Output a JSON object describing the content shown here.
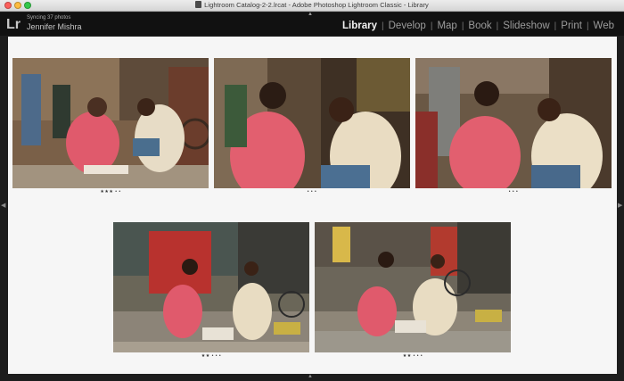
{
  "window": {
    "title": "Lightroom Catalog-2-2.lrcat - Adobe Photoshop Lightroom Classic - Library"
  },
  "identity": {
    "logo": "Lr",
    "sync_status": "Syncing 37 photos",
    "user_name": "Jennifer Mishra"
  },
  "modules": [
    {
      "label": "Library",
      "active": true
    },
    {
      "label": "Develop",
      "active": false
    },
    {
      "label": "Map",
      "active": false
    },
    {
      "label": "Book",
      "active": false
    },
    {
      "label": "Slideshow",
      "active": false
    },
    {
      "label": "Print",
      "active": false
    },
    {
      "label": "Web",
      "active": false
    }
  ],
  "survey": {
    "photos": [
      {
        "stars": "★★★",
        "rating": 3
      },
      {
        "stars": "",
        "rating": 0
      },
      {
        "stars": "",
        "rating": 0
      },
      {
        "stars": "★★",
        "rating": 2
      },
      {
        "stars": "★★",
        "rating": 2
      }
    ]
  },
  "colors": {
    "active_module": "#f2f2f2",
    "inactive_module": "#9c9c9c",
    "survey_bg": "#f6f6f6",
    "id_plate": "#111111"
  },
  "icons": {
    "panel_toggle": "triangle-icon"
  }
}
